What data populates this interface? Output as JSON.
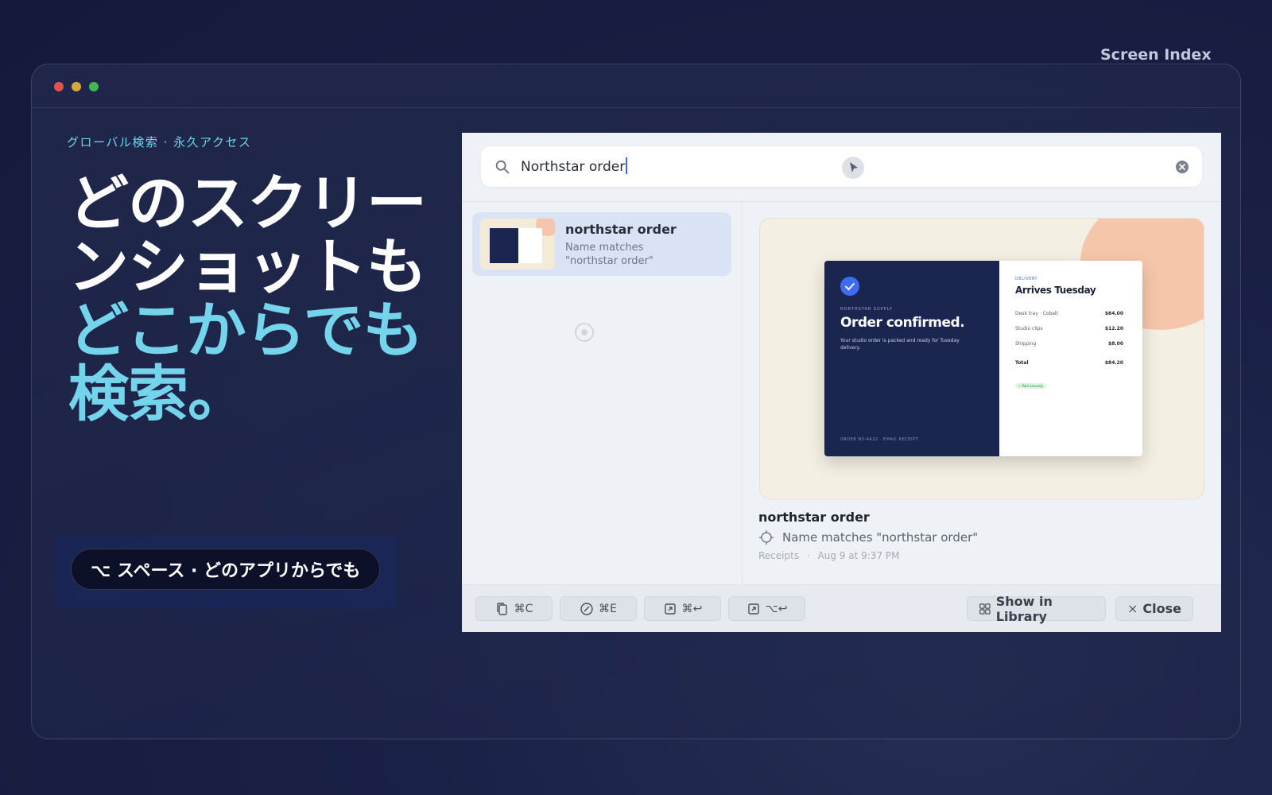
{
  "brand": "Screen Index",
  "hero": {
    "eyebrow": "グローバル検索 · 永久アクセス",
    "headline_line1": "どのスクリー",
    "headline_line2": "ンショットも",
    "headline_line3": "どこからでも",
    "headline_line4": "検索。",
    "shortcut": "⌥ スペース · どのアプリからでも"
  },
  "search": {
    "query": "Northstar order"
  },
  "results": [
    {
      "title": "northstar order",
      "subtitle_line1": "Name matches",
      "subtitle_line2": "\"northstar order\""
    }
  ],
  "preview": {
    "receipt": {
      "brand": "NORTHSTAR SUPPLY",
      "title": "Order confirmed.",
      "description": "Your studio order is packed and ready for Tuesday delivery.",
      "footer": "ORDER NS-4A20 · EMAIL RECEIPT",
      "delivery_label": "DELIVERY",
      "delivery_title": "Arrives Tuesday",
      "rows": [
        {
          "label": "Desk tray · Cobalt",
          "amount": "$64.00"
        },
        {
          "label": "Studio clips",
          "amount": "$12.20"
        },
        {
          "label": "Shipping",
          "amount": "$8.00"
        }
      ],
      "total_label": "Total",
      "total_amount": "$84.20",
      "badge": "✓ Paid securely"
    },
    "title": "northstar order",
    "match": "Name matches \"northstar order\"",
    "collection": "Receipts",
    "separator": "·",
    "date": "Aug 9 at 9:37 PM"
  },
  "toolbar": {
    "copy_shortcut": "⌘C",
    "edit_shortcut": "⌘E",
    "open_shortcut": "⌘↩",
    "open_alt_shortcut": "⌥↩",
    "show_in_library": "Show in Library",
    "close": "Close"
  },
  "colors": {
    "accent_cyan": "#74d4ec",
    "selection_blue": "#d9e3f5",
    "caret_blue": "#2f6cf0"
  }
}
